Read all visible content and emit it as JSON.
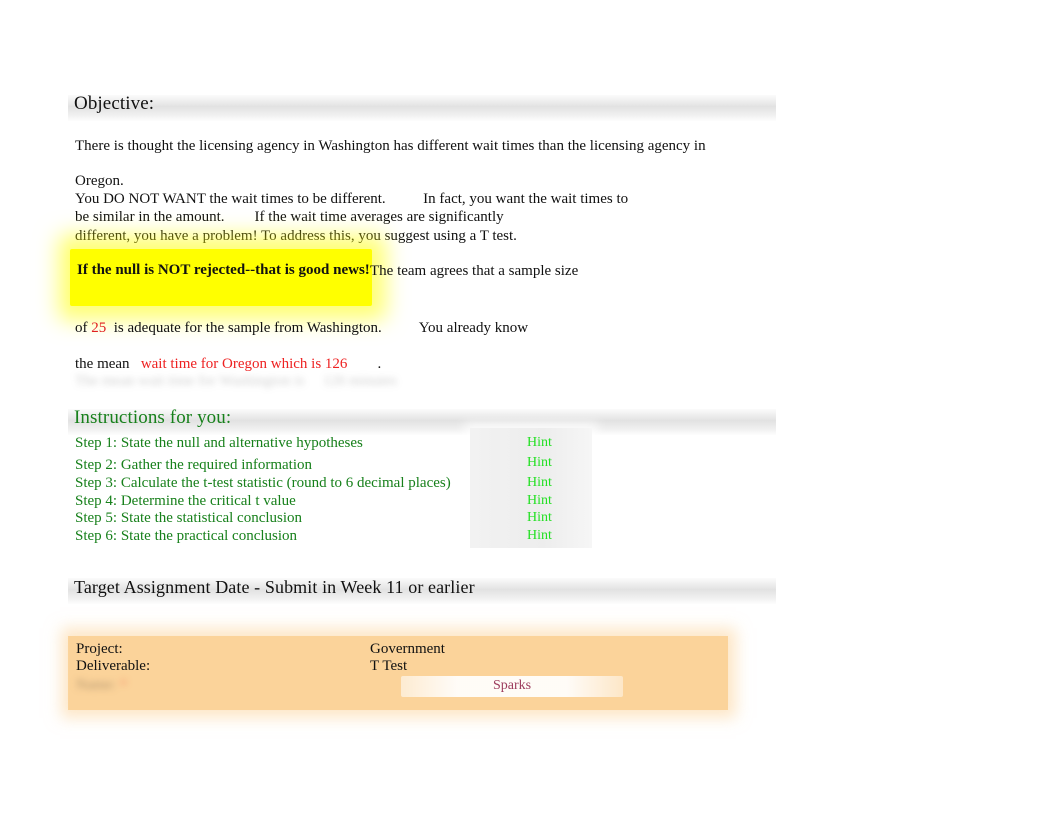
{
  "document": {
    "objective": {
      "heading": "Objective:",
      "intro": "There is thought the licensing agency in Washington has different wait times than the licensing agency in",
      "oregon": "Oregon.",
      "line1": "You DO NOT WANT the wait times to be different.          In fact, you want the wait times to",
      "line2": "be similar in the amount.        If the wait time averages are significantly",
      "line3": "different, you have a problem! To address this, you suggest using a T test.",
      "highlight_text": "If the null is NOT rejected--that is good news!",
      "team_text": "The team agrees that a sample size",
      "sample_size_prefix": "of ",
      "sample_size_value": "25",
      "sample_size_suffix": "  is adequate for the sample from Washington.          You already know",
      "mean_prefix": "the mean   ",
      "mean_red": "wait time for Oregon which is 126",
      "mean_suffix": "        .",
      "blurred_line": "The mean wait time for Washington is     126 minutes"
    },
    "instructions": {
      "heading": "Instructions for you:",
      "steps": [
        {
          "label": "Step 1: State the null and alternative hypotheses",
          "hint": "Hint"
        },
        {
          "label": "Step 2: Gather the required information",
          "hint": "Hint"
        },
        {
          "label": "Step 3: Calculate the t-test statistic (round to 6 decimal places)",
          "hint": "Hint"
        },
        {
          "label": "Step 4: Determine the critical t value",
          "hint": "Hint"
        },
        {
          "label": "Step 5: State the statistical conclusion",
          "hint": "Hint"
        },
        {
          "label": "Step 6: State the practical conclusion",
          "hint": "Hint"
        }
      ]
    },
    "target": {
      "heading": "Target Assignment Date - Submit in Week 11 or earlier"
    },
    "project_table": {
      "project_label": "Project:",
      "project_value": "Government",
      "deliverable_label": "Deliverable:",
      "deliverable_value": "T Test",
      "name_label": "Name:",
      "name_required": " *",
      "name_value": "Sparks"
    },
    "colors": {
      "accent_green": "#17801b",
      "hint_green": "#23e023",
      "red": "#e02020",
      "highlight_yellow": "#ffff00",
      "table_orange": "#fbd39a",
      "name_maroon": "#9c3b5c"
    }
  }
}
